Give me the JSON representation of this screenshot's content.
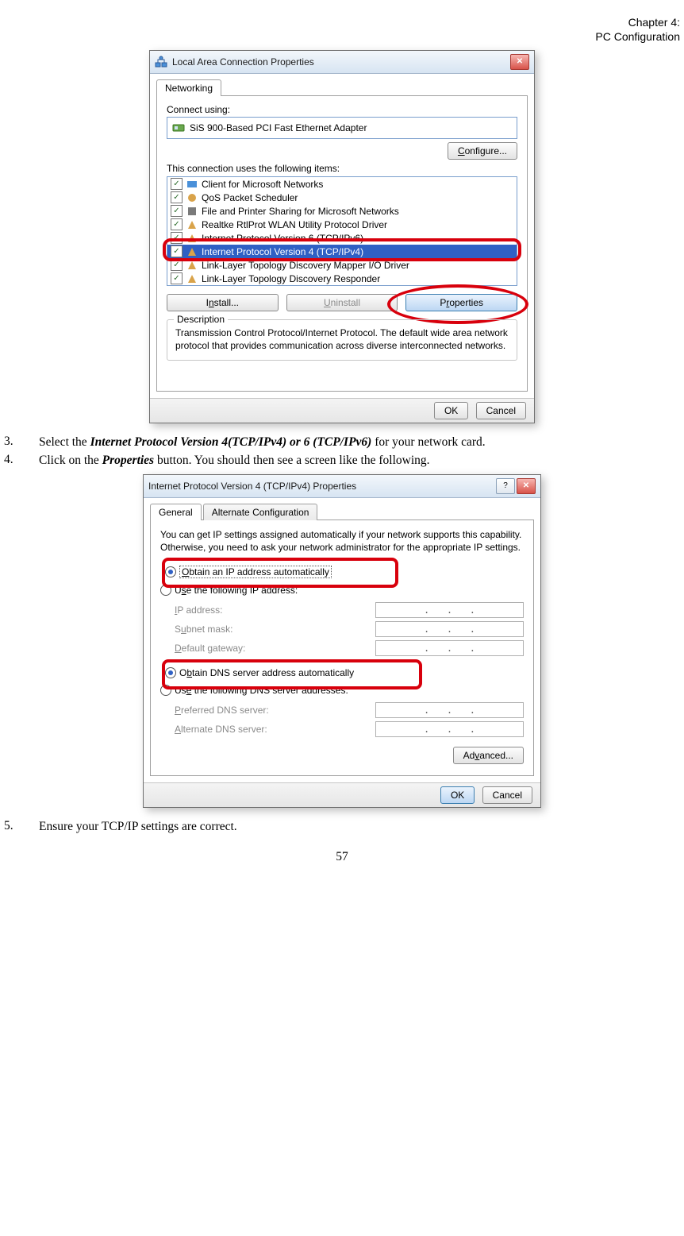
{
  "header": {
    "line1": "Chapter 4:",
    "line2": "PC Configuration"
  },
  "dialog1": {
    "title": "Local Area Connection Properties",
    "tab": "Networking",
    "connect_using_label": "Connect using:",
    "adapter": "SiS 900-Based PCI Fast Ethernet Adapter",
    "configure_btn": "Configure...",
    "items_label": "This connection uses the following items:",
    "items": [
      {
        "label": "Client for Microsoft Networks"
      },
      {
        "label": "QoS Packet Scheduler"
      },
      {
        "label": "File and Printer Sharing for Microsoft Networks"
      },
      {
        "label": "Realtke RtlProt WLAN Utility Protocol Driver"
      },
      {
        "label": "Internet Protocol Version 6 (TCP/IPv6)"
      },
      {
        "label": "Internet Protocol Version 4 (TCP/IPv4)"
      },
      {
        "label": "Link-Layer Topology Discovery Mapper I/O Driver"
      },
      {
        "label": "Link-Layer Topology Discovery Responder"
      }
    ],
    "install_btn": "Install...",
    "uninstall_btn": "Uninstall",
    "properties_btn": "Properties",
    "desc_title": "Description",
    "desc_text": "Transmission Control Protocol/Internet Protocol. The default wide area network protocol that provides communication across diverse interconnected networks.",
    "ok_btn": "OK",
    "cancel_btn": "Cancel"
  },
  "step3": {
    "num": "3.",
    "pre": "Select the ",
    "bold": "Internet Protocol Version 4(TCP/IPv4) or 6 (TCP/IPv6)",
    "post": " for your network card."
  },
  "step4": {
    "num": "4.",
    "pre": "Click on the ",
    "bold": "Properties",
    "post": " button. You should then see a screen like the following."
  },
  "dialog2": {
    "title": "Internet Protocol Version 4 (TCP/IPv4) Properties",
    "tab_general": "General",
    "tab_alt": "Alternate Configuration",
    "intro": "You can get IP settings assigned automatically if your network supports this capability. Otherwise, you need to ask your network administrator for the appropriate IP settings.",
    "r_obtain_ip": "Obtain an IP address automatically",
    "r_use_ip": "Use the following IP address:",
    "ip_label": "IP address:",
    "subnet_label": "Subnet mask:",
    "gateway_label": "Default gateway:",
    "r_obtain_dns": "Obtain DNS server address automatically",
    "r_use_dns": "Use the following DNS server addresses:",
    "pdns_label": "Preferred DNS server:",
    "adns_label": "Alternate DNS server:",
    "advanced_btn": "Advanced...",
    "ok_btn": "OK",
    "cancel_btn": "Cancel"
  },
  "step5": {
    "num": "5.",
    "text": "Ensure your TCP/IP settings are correct."
  },
  "page_num": "57"
}
